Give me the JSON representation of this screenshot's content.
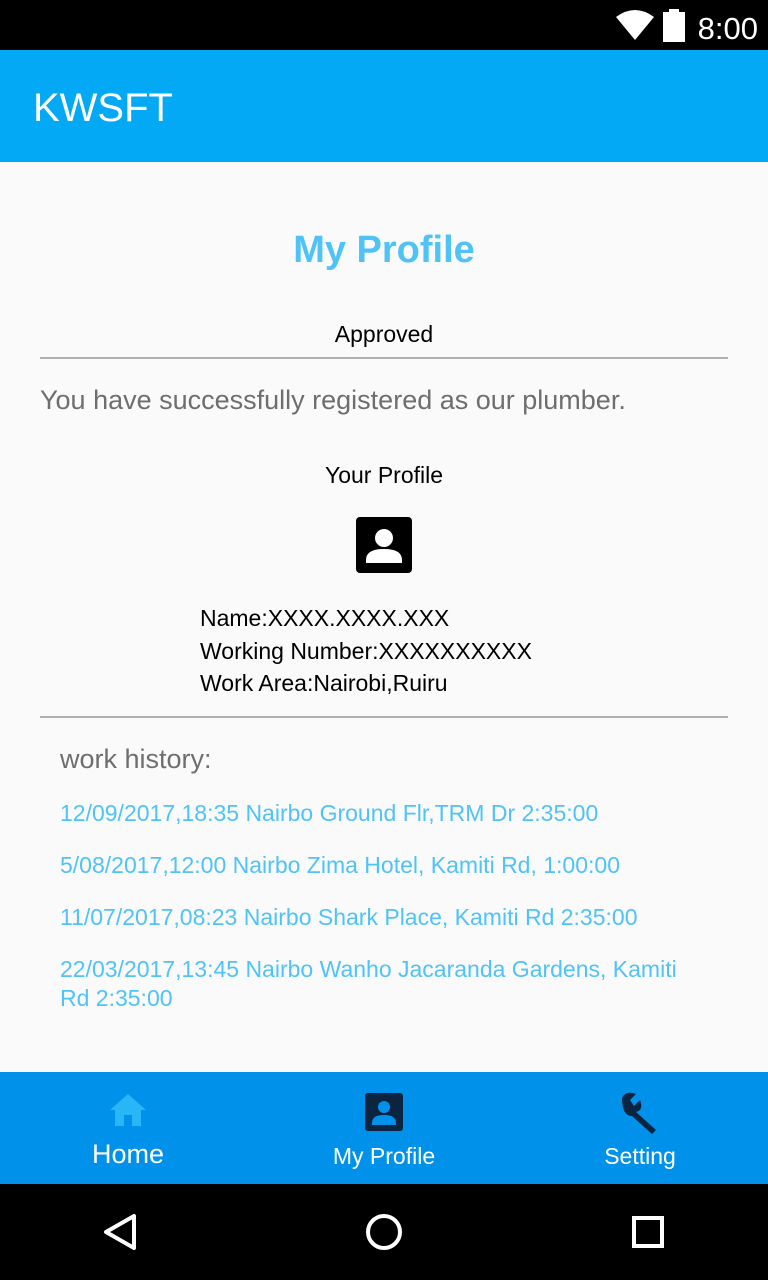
{
  "status_bar": {
    "time": "8:00",
    "icons": [
      "wifi-icon",
      "battery-icon"
    ]
  },
  "app_bar": {
    "title": "KWSFT",
    "color": "#03a9f4"
  },
  "main": {
    "page_title": "My Profile",
    "status": "Approved",
    "message": "You have successfully registered as our plumber.",
    "profile_heading": "Your Profile",
    "profile_icon": "account-box-icon",
    "name_line": "Name:XXXX.XXXX.XXX",
    "number_line": "Working Number:XXXXXXXXXX",
    "area_line": "Work Area:Nairobi,Ruiru",
    "history_title": "work history:",
    "history": [
      "12/09/2017,18:35 Nairbo Ground Flr,TRM Dr 2:35:00",
      "5/08/2017,12:00 Nairbo Zima Hotel, Kamiti Rd, 1:00:00",
      "11/07/2017,08:23 Nairbo Shark Place, Kamiti Rd 2:35:00",
      "22/03/2017,13:45 Nairbo Wanho Jacaranda Gardens, Kamiti Rd 2:35:00"
    ],
    "accent_color": "#4fc3f7"
  },
  "bottom_nav": {
    "color": "#0091ea",
    "items": [
      {
        "label": "Home",
        "icon": "home-icon"
      },
      {
        "label": "My Profile",
        "icon": "account-box-icon"
      },
      {
        "label": "Setting",
        "icon": "wrench-icon"
      }
    ]
  },
  "system_nav": {
    "icons": [
      "back-icon",
      "home-circle-icon",
      "recents-icon"
    ]
  }
}
